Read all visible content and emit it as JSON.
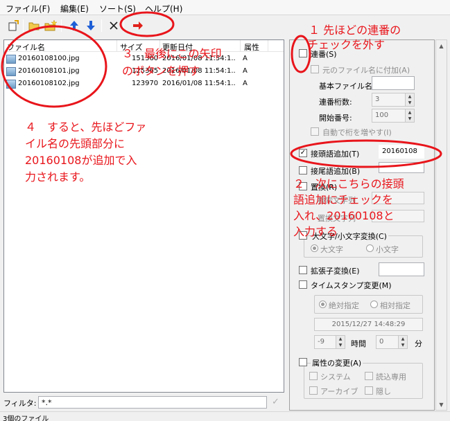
{
  "menu": {
    "file": "ファイル(F)",
    "edit": "編集(E)",
    "sort": "ソート(S)",
    "help": "ヘルプ(H)"
  },
  "toolbar": {
    "icons": [
      "new-file-icon",
      "open-folder-icon",
      "folder-star-icon",
      "up-arrow-icon",
      "down-arrow-icon",
      "delete-x-icon",
      "execute-arrow-icon"
    ]
  },
  "list": {
    "headers": {
      "name": "ファイル名",
      "size": "サイズ",
      "date": "更新日付",
      "attr": "属性"
    },
    "rows": [
      {
        "name": "20160108100.jpg",
        "size": "151360",
        "date": "2016/01/08 11:54:1..",
        "attr": "A"
      },
      {
        "name": "20160108101.jpg",
        "size": "125365",
        "date": "2016/01/08 11:54:1..",
        "attr": "A"
      },
      {
        "name": "20160108102.jpg",
        "size": "123970",
        "date": "2016/01/08 11:54:1..",
        "attr": "A"
      }
    ]
  },
  "filter": {
    "label": "フィルタ:",
    "value": "*.*"
  },
  "status": {
    "text": "3個のファイル"
  },
  "panel": {
    "serial": {
      "label": "連番(S)"
    },
    "append_original": {
      "label": "元のファイル名に付加(A)"
    },
    "base_name": {
      "label": "基本ファイル名:",
      "value": ""
    },
    "digits": {
      "label": "連番桁数:",
      "value": "3"
    },
    "start": {
      "label": "開始番号:",
      "value": "100"
    },
    "auto_digits": {
      "label": "自動で桁を増やす(I)"
    },
    "prefix": {
      "label": "接頭語追加(T)",
      "value": "20160108"
    },
    "suffix": {
      "label": "接尾語追加(B)",
      "value": ""
    },
    "replace": {
      "label": "置換(R)",
      "search_label": "検索文字列",
      "replace_label": "置換文字列"
    },
    "case": {
      "label": "大文字/小文字変換(C)",
      "upper": "大文字",
      "lower": "小文字"
    },
    "ext": {
      "label": "拡張子変換(E)",
      "value": ""
    },
    "timestamp": {
      "label": "タイムスタンプ変更(M)",
      "absolute": "絶対指定",
      "relative": "相対指定",
      "datetime": "2015/12/27 14:48:29",
      "hours_value": "-9",
      "hours_unit": "時間",
      "minutes_value": "0",
      "minutes_unit": "分"
    },
    "attr": {
      "label": "属性の変更(A)",
      "system": "システム",
      "readonly": "読込専用",
      "archive": "アーカイブ",
      "hidden": "隠し"
    }
  },
  "annotations": {
    "a1_line1": "１ 先ほどの連番の",
    "a1_line2": "チェックを外す",
    "a2_line1": "２　次にこちらの接頭",
    "a2_line2": "語追加にチェックを",
    "a2_line3": "入れ、20160108と",
    "a2_line4": "入力する",
    "a3_line1": "３　最後にこの矢印",
    "a3_line2": "のボタンを押す",
    "a4_line1": "４　すると、先ほどファ",
    "a4_line2": "イル名の先頭部分に",
    "a4_line3": "20160108が追加で入",
    "a4_line4": "力されます。"
  },
  "colors": {
    "annotation": "#e8151b",
    "toolbar_blue": "#1e5fd6",
    "toolbar_red": "#e0201a"
  }
}
